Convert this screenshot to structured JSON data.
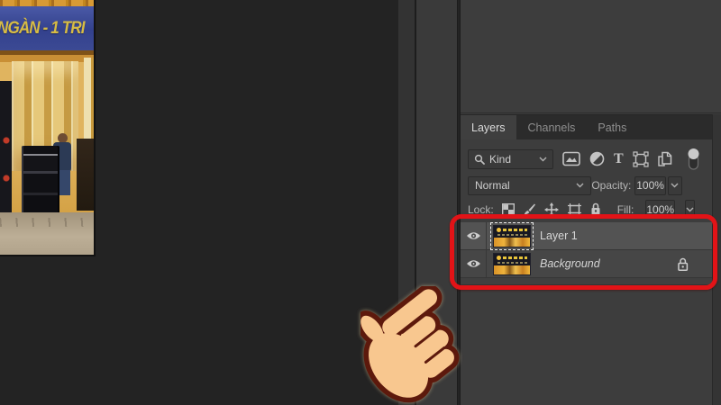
{
  "photo": {
    "banner_text": "NGÀN - 1 TRI"
  },
  "layers_panel": {
    "tabs": [
      {
        "label": "Layers",
        "active": true
      },
      {
        "label": "Channels",
        "active": false
      },
      {
        "label": "Paths",
        "active": false
      }
    ],
    "filter": {
      "kind_label": "Kind",
      "type_icon_glyph": "T",
      "type_icons": [
        "pixel-layer-filter",
        "adjustment-layer-filter",
        "type-layer-filter",
        "shape-layer-filter",
        "smart-object-filter",
        "filter-toggle-switch"
      ]
    },
    "blend": {
      "mode": "Normal",
      "opacity_label": "Opacity:",
      "opacity_value": "100%"
    },
    "lock": {
      "label": "Lock:",
      "fill_label": "Fill:",
      "fill_value": "100%",
      "lock_icons": [
        "lock-transparent-pixels",
        "lock-image-pixels",
        "lock-position",
        "lock-artboard-nesting",
        "lock-all"
      ]
    },
    "layers": [
      {
        "name": "Layer 1",
        "selected": true,
        "visible": true,
        "locked": false
      },
      {
        "name": "Background",
        "selected": false,
        "visible": true,
        "locked": true
      }
    ]
  },
  "annotation": {
    "highlight_color": "#e21317",
    "pointer": "hand-pointing-up-right"
  },
  "colors": {
    "panel_bg": "#3d3d3d",
    "canvas_bg": "#232323",
    "selected_row": "#535353",
    "highlight_red": "#e21317"
  }
}
